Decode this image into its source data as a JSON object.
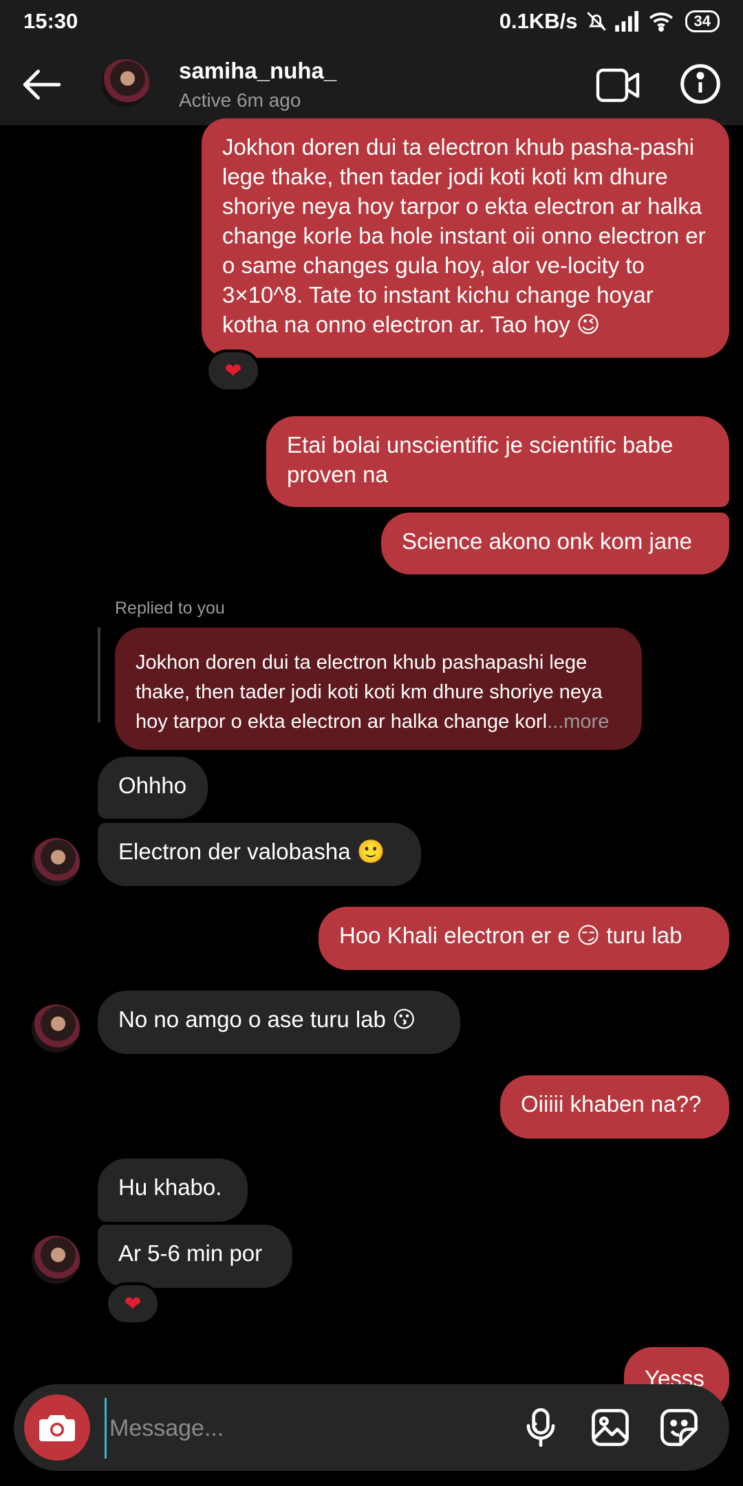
{
  "status_bar": {
    "time": "15:30",
    "network_speed": "0.1KB/s",
    "battery": "34"
  },
  "header": {
    "username": "samiha_nuha_",
    "active_status": "Active 6m ago"
  },
  "messages": [
    {
      "side": "sent",
      "text": "Jokhon doren dui ta electron khub  pasha-pashi lege thake, then tader jodi koti koti km dhure shoriye neya hoy tarpor o ekta electron ar halka change korle ba hole instant oii onno electron er o same changes gula hoy, alor ve-locity to 3×10^8. Tate to instant kichu change hoyar kotha na onno electron ar. Tao hoy 😉",
      "reaction": "❤"
    },
    {
      "side": "sent",
      "text": "Etai bolai unscientific je scientific babe proven na"
    },
    {
      "side": "sent",
      "text": "Science akono onk kom jane"
    },
    {
      "side": "received",
      "reply_label": "Replied to you",
      "quoted_text": "Jokhon doren dui ta electron khub  pashapashi lege thake, then tader jodi koti koti km dhure shoriye neya hoy tarpor o ekta electron ar halka change korl",
      "more_label": "...more",
      "text": "Ohhho"
    },
    {
      "side": "received",
      "text": "Electron der valobasha 🙂"
    },
    {
      "side": "sent",
      "text": "Hoo Khali electron er e 😏 turu lab"
    },
    {
      "side": "received",
      "text": "No no amgo o ase turu lab 😗"
    },
    {
      "side": "sent",
      "text": "Oiiiii khaben na??"
    },
    {
      "side": "received",
      "text": "Hu khabo."
    },
    {
      "side": "received",
      "text": "Ar 5-6 min por",
      "reaction": "❤"
    },
    {
      "side": "sent",
      "text": "Yesss"
    }
  ],
  "composer": {
    "placeholder": "Message..."
  },
  "icons": {
    "back": "arrow-left-icon",
    "video": "video-camera-icon",
    "info": "info-icon",
    "camera": "camera-icon",
    "mic": "microphone-icon",
    "gallery": "image-icon",
    "sticker": "sticker-icon"
  },
  "colors": {
    "sent_bubble": "#b7373e",
    "received_bubble": "#262626",
    "quoted_bubble": "#5e1a1f",
    "background": "#000000",
    "header": "#1c1c1c"
  }
}
